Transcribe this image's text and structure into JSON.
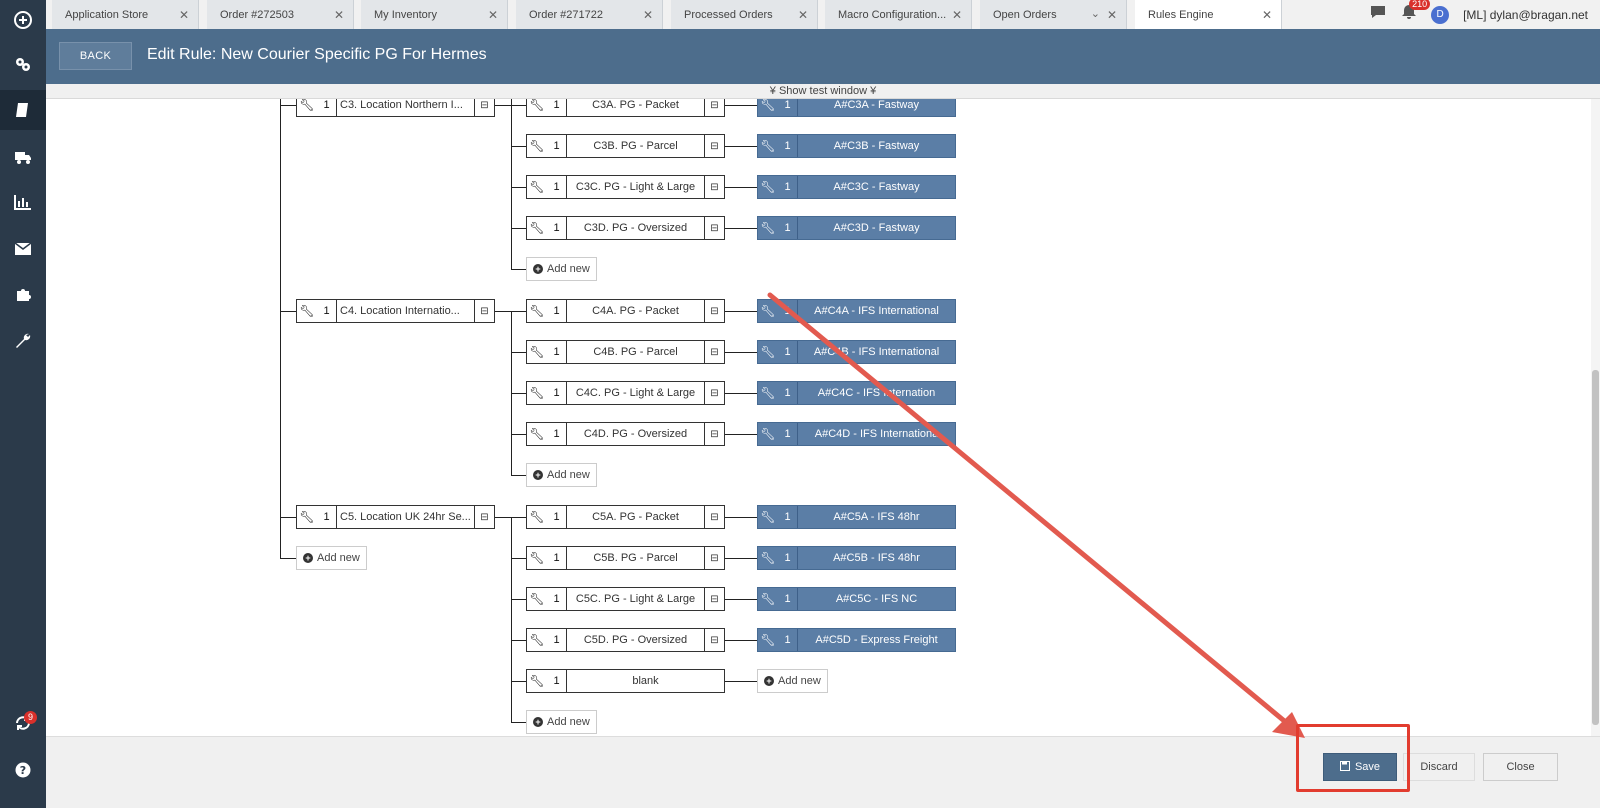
{
  "tabs": [
    {
      "label": "Application Store"
    },
    {
      "label": "Order #272503"
    },
    {
      "label": "My Inventory"
    },
    {
      "label": "Order #271722"
    },
    {
      "label": "Processed Orders"
    },
    {
      "label": "Macro Configuration..."
    },
    {
      "label": "Open Orders"
    },
    {
      "label": "Rules Engine"
    }
  ],
  "topbar": {
    "notifications_count": "210",
    "avatar_letter": "D",
    "user": "[ML] dylan@bragan.net"
  },
  "sidebar": {
    "sync_badge": "9"
  },
  "header": {
    "back_label": "BACK",
    "title": "Edit Rule: New Courier Specific PG For Hermes"
  },
  "test_window": "¥ Show test window ¥",
  "tree": {
    "groups": [
      {
        "num": "1",
        "label": "C3. Location Northern I...",
        "children": [
          {
            "num": "1",
            "label": "C3A. PG - Packet",
            "action_num": "1",
            "action": "A#C3A - Fastway"
          },
          {
            "num": "1",
            "label": "C3B. PG - Parcel",
            "action_num": "1",
            "action": "A#C3B - Fastway"
          },
          {
            "num": "1",
            "label": "C3C. PG - Light & Large",
            "action_num": "1",
            "action": "A#C3C - Fastway"
          },
          {
            "num": "1",
            "label": "C3D. PG - Oversized",
            "action_num": "1",
            "action": "A#C3D - Fastway"
          }
        ],
        "add_new": "Add new"
      },
      {
        "num": "1",
        "label": "C4. Location Internatio...",
        "children": [
          {
            "num": "1",
            "label": "C4A. PG - Packet",
            "action_num": "1",
            "action": "A#C4A - IFS International"
          },
          {
            "num": "1",
            "label": "C4B. PG - Parcel",
            "action_num": "1",
            "action": "A#C4B - IFS International"
          },
          {
            "num": "1",
            "label": "C4C. PG - Light & Large",
            "action_num": "1",
            "action": "A#C4C - IFS Internation"
          },
          {
            "num": "1",
            "label": "C4D. PG - Oversized",
            "action_num": "1",
            "action": "A#C4D - IFS Internationa"
          }
        ],
        "add_new": "Add new"
      },
      {
        "num": "1",
        "label": "C5. Location UK 24hr Se...",
        "children": [
          {
            "num": "1",
            "label": "C5A. PG - Packet",
            "action_num": "1",
            "action": "A#C5A - IFS 48hr"
          },
          {
            "num": "1",
            "label": "C5B. PG - Parcel",
            "action_num": "1",
            "action": "A#C5B - IFS 48hr"
          },
          {
            "num": "1",
            "label": "C5C. PG - Light & Large",
            "action_num": "1",
            "action": "A#C5C - IFS NC"
          },
          {
            "num": "1",
            "label": "C5D. PG - Oversized",
            "action_num": "1",
            "action": "A#C5D - Express Freight"
          },
          {
            "num": "1",
            "label": "blank",
            "action_add_new": "Add new"
          }
        ],
        "add_new": "Add new"
      }
    ],
    "root_add_new": "Add new"
  },
  "footer": {
    "save": "Save",
    "discard": "Discard",
    "close": "Close"
  },
  "colors": {
    "header": "#4d6d8c",
    "sidebar": "#2b3a4a",
    "action_box": "#5b7ea6",
    "annotation_red": "#e23c2f"
  }
}
